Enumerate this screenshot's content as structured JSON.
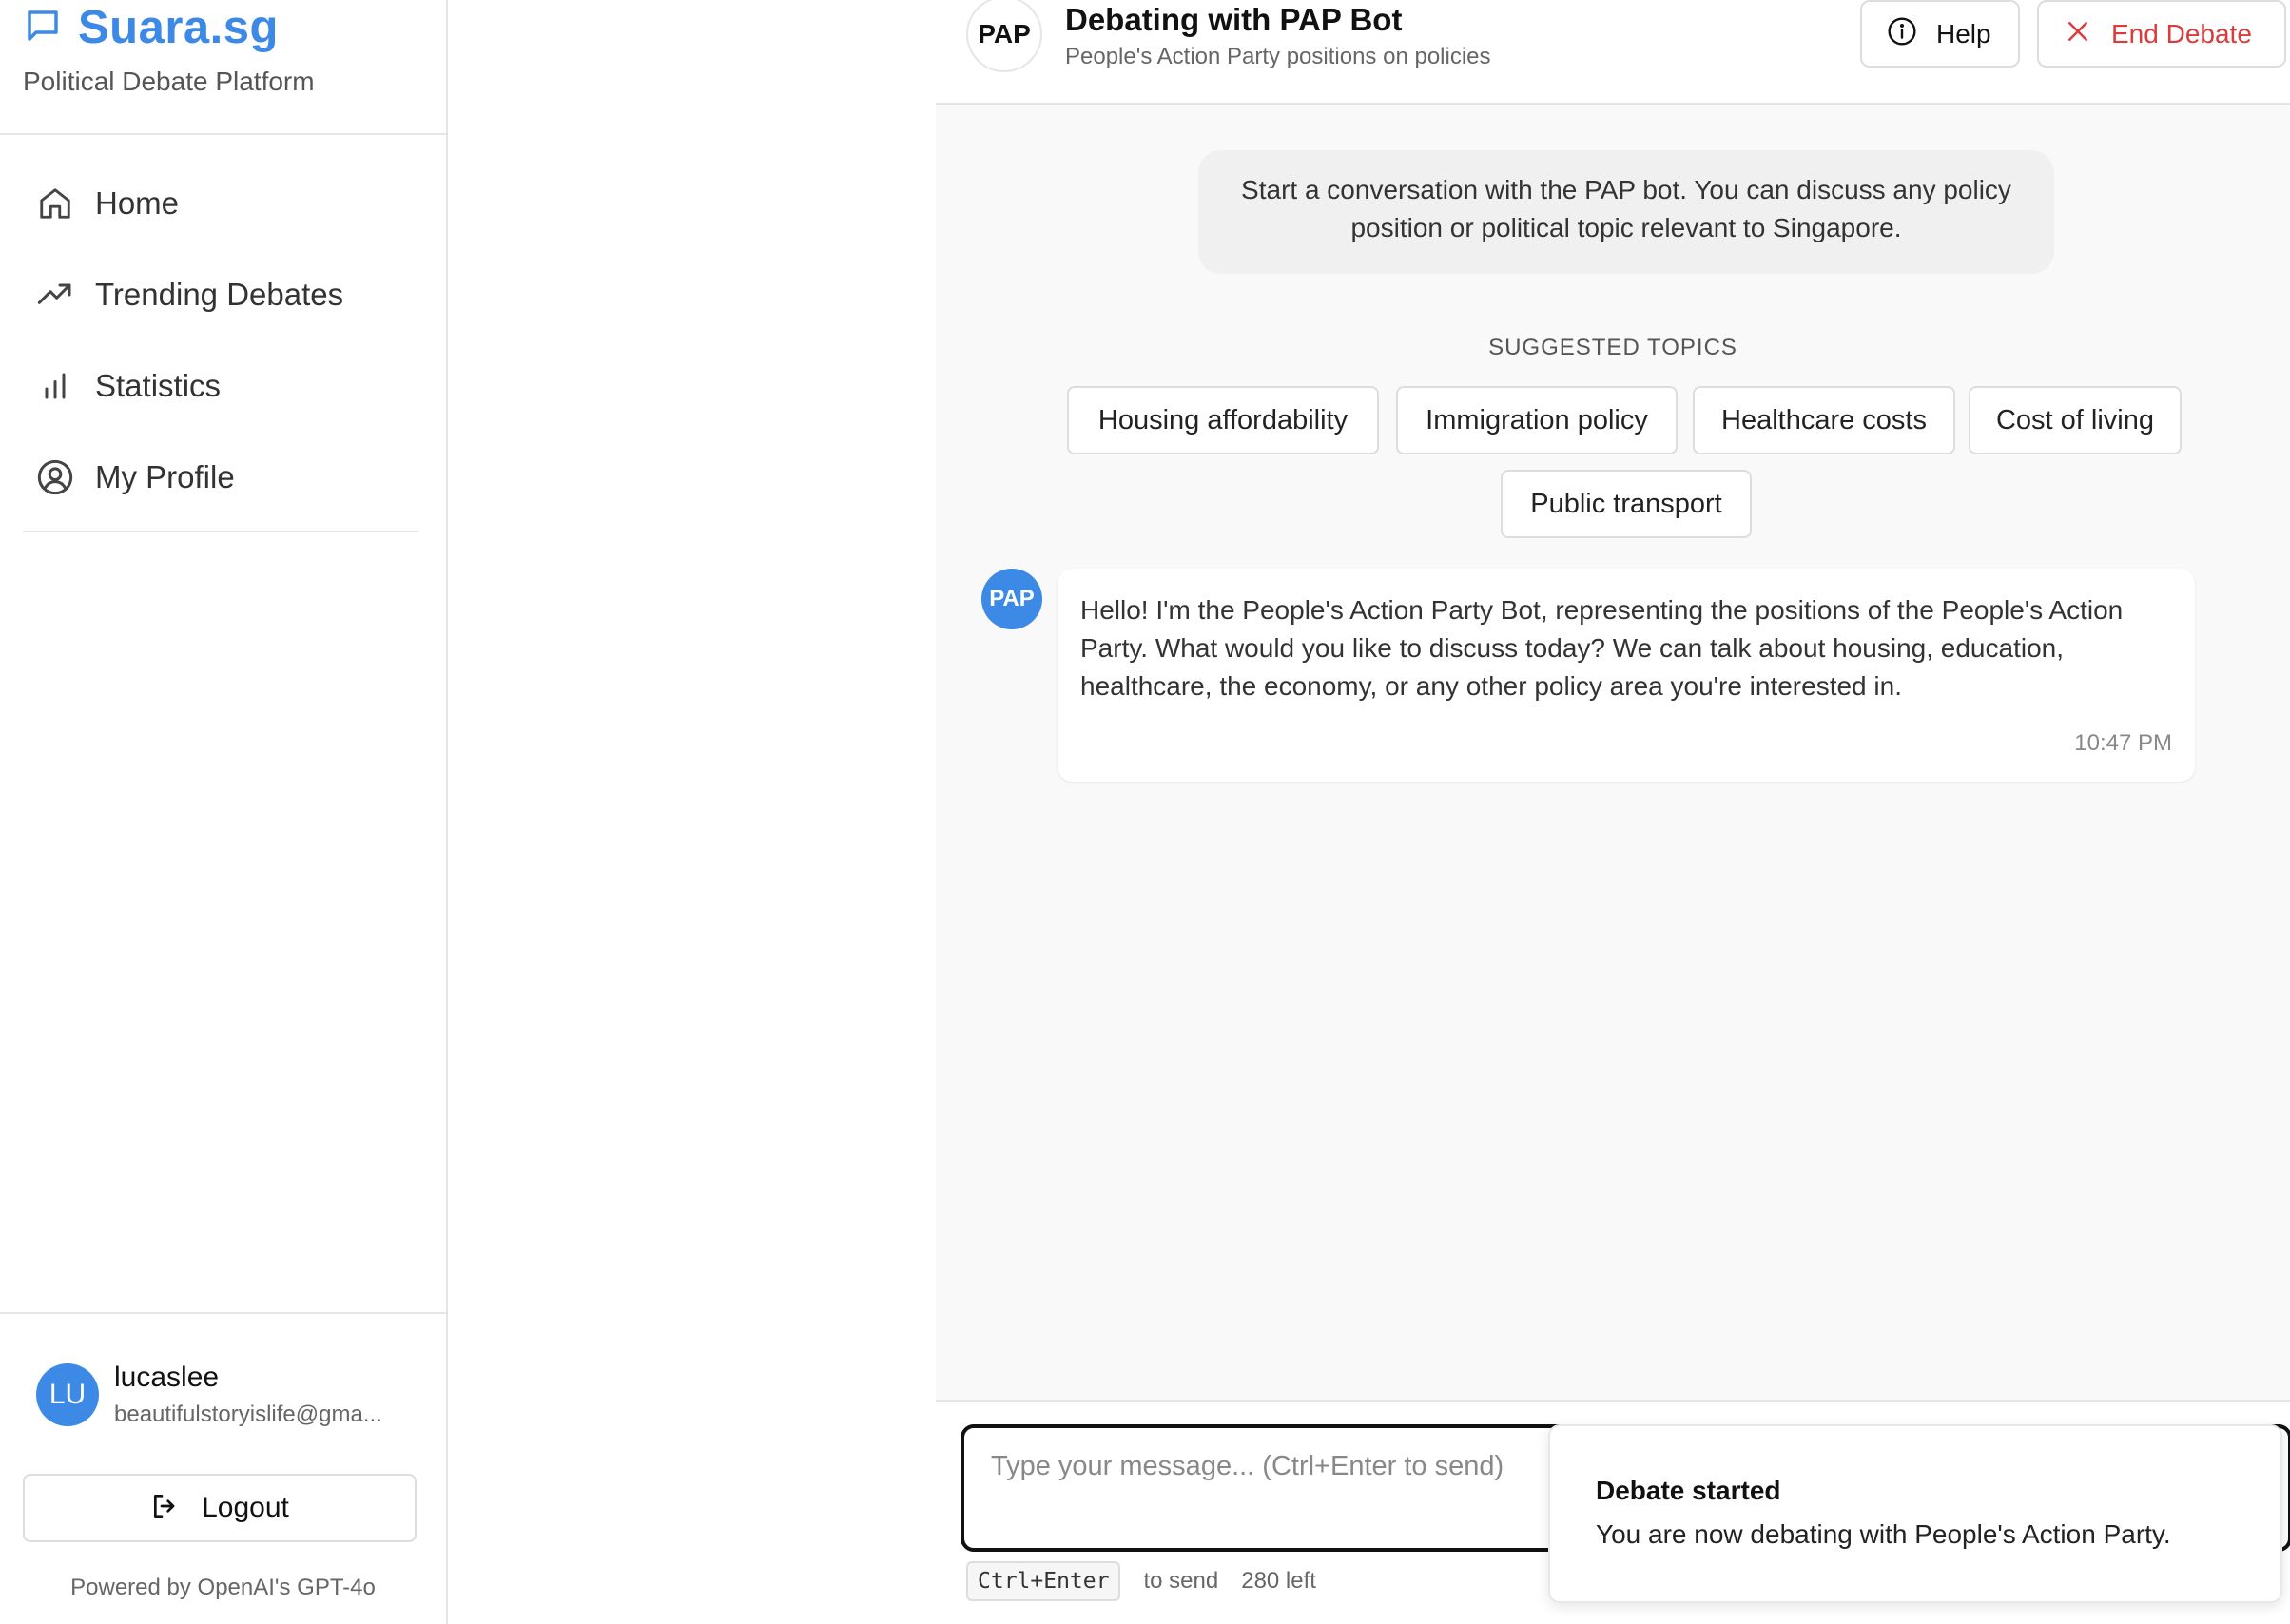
{
  "sidebar": {
    "brand_name": "Suara.sg",
    "brand_sub": "Political Debate Platform",
    "nav": [
      {
        "label": "Home",
        "icon": "home-icon"
      },
      {
        "label": "Trending Debates",
        "icon": "trending-icon"
      },
      {
        "label": "Statistics",
        "icon": "bar-chart-icon"
      },
      {
        "label": "My Profile",
        "icon": "user-circle-icon"
      }
    ],
    "user": {
      "initials": "LU",
      "name": "lucaslee",
      "email": "beautifulstoryislife@gma..."
    },
    "logout_label": "Logout",
    "powered_by": "Powered by OpenAI's GPT-4o"
  },
  "header": {
    "avatar_text": "PAP",
    "title": "Debating with PAP Bot",
    "subtitle": "People's Action Party positions on policies",
    "help_label": "Help",
    "end_label": "End Debate"
  },
  "chat": {
    "intro": "Start a conversation with the PAP bot. You can discuss any policy position or political topic relevant to Singapore.",
    "suggested_heading": "SUGGESTED TOPICS",
    "topics": [
      "Housing affordability",
      "Immigration policy",
      "Healthcare costs",
      "Cost of living",
      "Public transport"
    ],
    "messages": [
      {
        "sender": "PAP",
        "text": "Hello! I'm the People's Action Party Bot, representing the positions of the People's Action Party. What would you like to discuss today? We can talk about housing, education, healthcare, the economy, or any other policy area you're interested in.",
        "time": "10:47 PM"
      }
    ]
  },
  "composer": {
    "placeholder": "Type your message... (Ctrl+Enter to send)",
    "shortcut": "Ctrl+Enter",
    "shortcut_hint": "to send",
    "remaining": "280 left"
  },
  "toast": {
    "title": "Debate started",
    "message": "You are now debating with People's Action Party."
  },
  "colors": {
    "accent": "#3d8ae6",
    "danger": "#dc3b3b"
  }
}
